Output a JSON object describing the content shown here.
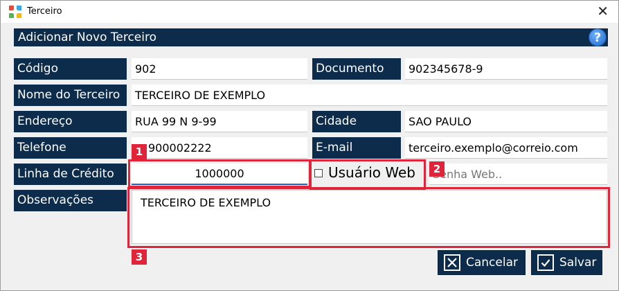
{
  "window": {
    "title": "Terceiro",
    "close": "✕"
  },
  "form": {
    "header": "Adicionar Novo Terceiro",
    "help": "?",
    "fields": {
      "codigo": {
        "label": "Código",
        "value": "902"
      },
      "documento": {
        "label": "Documento",
        "value": "902345678-9"
      },
      "nome": {
        "label": "Nome do Terceiro",
        "value": "TERCEIRO DE EXEMPLO"
      },
      "endereco": {
        "label": "Endereço",
        "value": "RUA 99 N 9-99"
      },
      "cidade": {
        "label": "Cidade",
        "value": "SAO PAULO"
      },
      "telefone": {
        "label": "Telefone",
        "value": "900002222"
      },
      "email": {
        "label": "E-mail",
        "value": "terceiro.exemplo@correio.com"
      },
      "linha_credito": {
        "label": "Linha de Crédito",
        "value": "1000000"
      },
      "usuario_web": {
        "label": "Usuário Web",
        "checked": false
      },
      "senha_web": {
        "placeholder": "Senha Web.."
      },
      "observacoes": {
        "label": "Observações",
        "value": "TERCEIRO DE EXEMPLO"
      }
    },
    "buttons": {
      "cancel": "Cancelar",
      "save": "Salvar"
    }
  },
  "annotations": [
    "1",
    "2",
    "3"
  ],
  "colors": {
    "accent": "#0d2c4b",
    "highlight": "#e0243a",
    "focus": "#1e64c8"
  }
}
